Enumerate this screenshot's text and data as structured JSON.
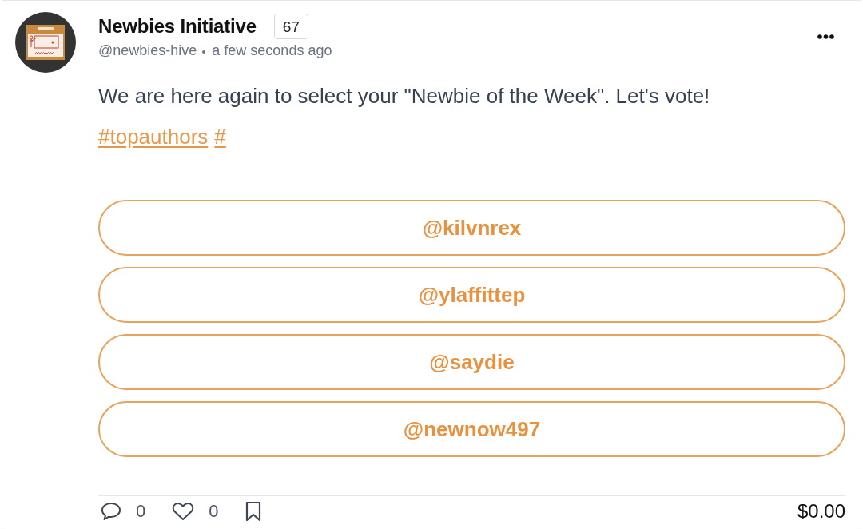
{
  "post": {
    "author": {
      "name": "Newbies Initiative",
      "reputation": "67",
      "handle": "@newbies-hive",
      "time": "a few seconds ago"
    },
    "body": "We are here again to select your \"Newbie of the Week\". Let's vote!",
    "tags": [
      "#topauthors",
      "#"
    ],
    "poll_options": [
      {
        "label": "@kilvnrex"
      },
      {
        "label": "@ylaffittep"
      },
      {
        "label": "@saydie"
      },
      {
        "label": "@newnow497"
      }
    ],
    "footer": {
      "comments": "0",
      "likes": "0",
      "payout": "$0.00"
    }
  }
}
